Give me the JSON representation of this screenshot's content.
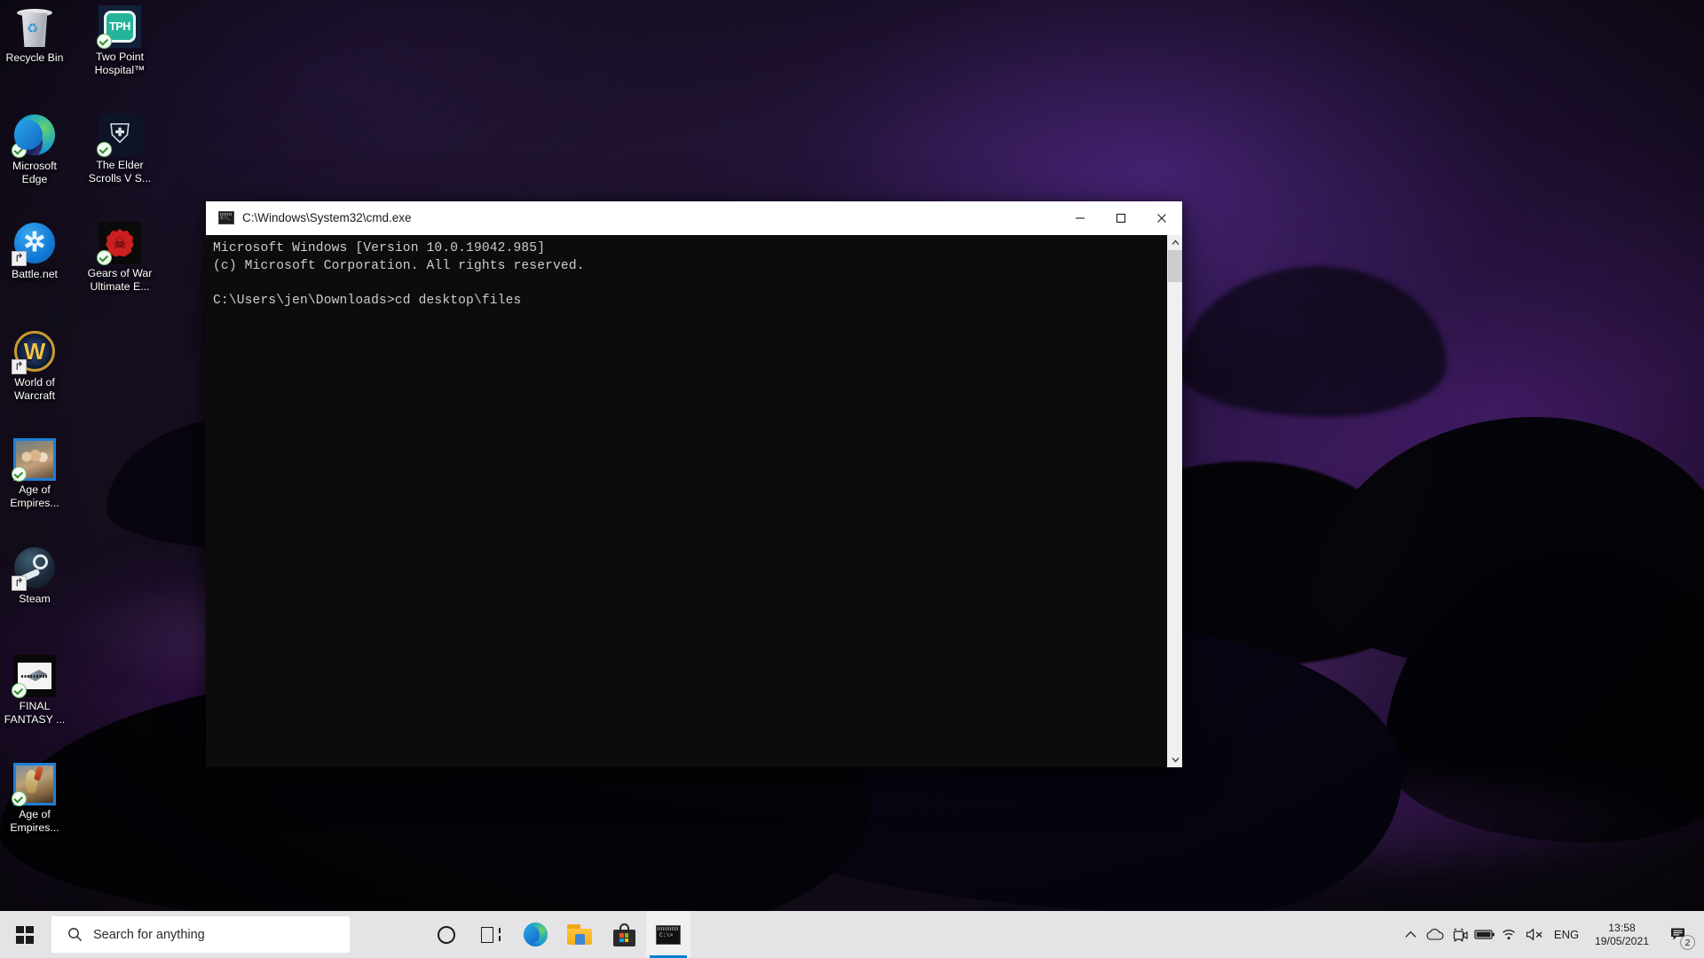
{
  "desktop": {
    "icons": [
      {
        "label": "Recycle Bin",
        "art": "recycle-bin-icon",
        "overlay": "none"
      },
      {
        "label": "Two Point Hospital™",
        "art": "two-point-hospital-icon",
        "overlay": "sync"
      },
      {
        "label": "Microsoft Edge",
        "art": "microsoft-edge-icon",
        "overlay": "sync"
      },
      {
        "label": "The Elder Scrolls V S...",
        "art": "elder-scrolls-skyrim-icon",
        "overlay": "sync"
      },
      {
        "label": "Battle.net",
        "art": "battle-net-icon",
        "overlay": "shortcut"
      },
      {
        "label": "Gears of War Ultimate E...",
        "art": "gears-of-war-icon",
        "overlay": "sync"
      },
      {
        "label": "World of Warcraft",
        "art": "world-of-warcraft-icon",
        "overlay": "shortcut"
      },
      {
        "label": "Age of Empires...",
        "art": "age-of-empires-2-icon",
        "overlay": "sync"
      },
      {
        "label": "Steam",
        "art": "steam-icon",
        "overlay": "shortcut"
      },
      {
        "label": "FINAL FANTASY ...",
        "art": "final-fantasy-icon",
        "overlay": "sync"
      },
      {
        "label": "Age of Empires...",
        "art": "age-of-empires-4-icon",
        "overlay": "sync"
      }
    ]
  },
  "cmd_window": {
    "title": "C:\\Windows\\System32\\cmd.exe",
    "console_lines": [
      "Microsoft Windows [Version 10.0.19042.985]",
      "(c) Microsoft Corporation. All rights reserved.",
      "",
      "C:\\Users\\jen\\Downloads>cd desktop\\files"
    ],
    "console_text": "Microsoft Windows [Version 10.0.19042.985]\n(c) Microsoft Corporation. All rights reserved.\n\nC:\\Users\\jen\\Downloads>cd desktop\\files",
    "controls": {
      "minimize": "minimize-icon",
      "maximize": "maximize-icon",
      "close": "close-icon"
    },
    "background_color": "#0c0c0c",
    "text_color": "#cccccc"
  },
  "taskbar": {
    "start": "windows-logo",
    "search": {
      "placeholder": "Search for anything",
      "icon": "search-icon"
    },
    "apps": [
      {
        "name": "cortana-icon",
        "label": "Cortana",
        "active": false
      },
      {
        "name": "task-view-icon",
        "label": "Task View",
        "active": false
      },
      {
        "name": "microsoft-edge-icon",
        "label": "Microsoft Edge",
        "active": false
      },
      {
        "name": "file-explorer-icon",
        "label": "File Explorer",
        "active": false
      },
      {
        "name": "microsoft-store-icon",
        "label": "Microsoft Store",
        "active": false
      },
      {
        "name": "command-prompt-icon",
        "label": "Command Prompt",
        "active": true
      }
    ],
    "tray": [
      {
        "name": "show-hidden-icons-chevron",
        "glyph": "^"
      },
      {
        "name": "onedrive-icon",
        "glyph": "cloud"
      },
      {
        "name": "camera-icon",
        "glyph": "camera"
      },
      {
        "name": "battery-icon",
        "glyph": "battery"
      },
      {
        "name": "wifi-icon",
        "glyph": "wifi"
      },
      {
        "name": "volume-muted-icon",
        "glyph": "speaker-mute"
      },
      {
        "name": "language-indicator",
        "glyph": "ENG"
      }
    ],
    "language": "ENG",
    "clock": {
      "time": "13:58",
      "date": "19/05/2021"
    },
    "notifications": {
      "icon": "action-center-icon",
      "count": "2"
    },
    "accent_color": "#0b7fd4",
    "background_color": "#e4e4e6"
  }
}
